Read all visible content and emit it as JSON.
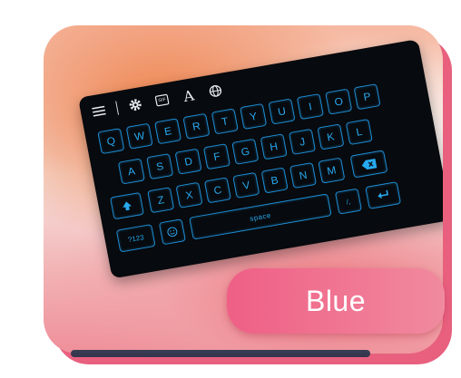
{
  "theme_label": "Blue",
  "colors": {
    "key_border": "#1e8fd6",
    "key_text": "#27a9f0",
    "keyboard_bg": "#070a0e",
    "pill": "#ef5f86"
  },
  "toolbar": {
    "icons": [
      "menu-icon",
      "gear-icon",
      "sticker-icon",
      "font-icon",
      "globe-icon"
    ],
    "font_glyph": "A",
    "sticker_text": "GIF"
  },
  "keys": {
    "row1": [
      "Q",
      "W",
      "E",
      "R",
      "T",
      "Y",
      "U",
      "I",
      "O",
      "P"
    ],
    "row2": [
      "A",
      "S",
      "D",
      "F",
      "G",
      "H",
      "J",
      "K",
      "L"
    ],
    "row3": [
      "Z",
      "X",
      "C",
      "V",
      "B",
      "N",
      "M"
    ],
    "numbers_key": "?123",
    "space_label": "space",
    "punct_key": "/,"
  }
}
